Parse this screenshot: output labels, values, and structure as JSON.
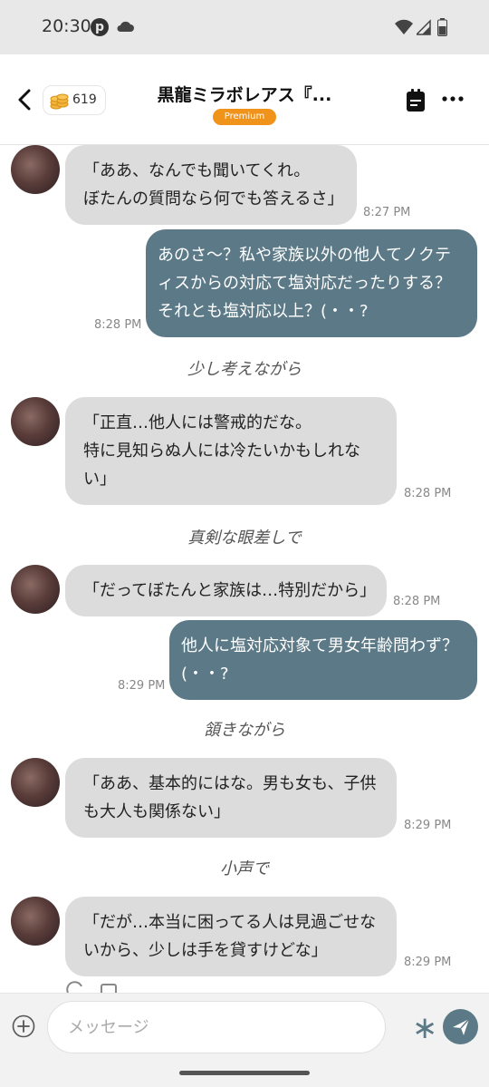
{
  "status_bar": {
    "time": "20:30",
    "icons": [
      "pinterest-icon",
      "cloud-icon",
      "wifi-icon",
      "signal-icon",
      "battery-icon"
    ]
  },
  "header": {
    "coin_count": "619",
    "title": "黒龍ミラボレアス『...",
    "badge": "Premium",
    "accent_color": "#f0931b"
  },
  "messages": [
    {
      "type": "char",
      "lines": [
        "「ああ、なんでも聞いてくれ。",
        "ぼたんの質問なら何でも答えるさ」"
      ],
      "time": "8:27 PM"
    },
    {
      "type": "user",
      "lines": [
        "あのさ～？私や家族以外の他人てノクテ",
        "ィスからの対応て塩対応だったりする？",
        "それとも塩対応以上？(・・?"
      ],
      "time": "8:28 PM"
    },
    {
      "type": "narration",
      "text": "少し考えながら"
    },
    {
      "type": "char",
      "lines": [
        "「正直…他人には警戒的だな。",
        "特に見知らぬ人には冷たいかもしれな",
        "い」"
      ],
      "time": "8:28 PM"
    },
    {
      "type": "narration",
      "text": "真剣な眼差しで"
    },
    {
      "type": "char",
      "lines": [
        "「だってぼたんと家族は…特別だから」"
      ],
      "time": "8:28 PM"
    },
    {
      "type": "user",
      "lines": [
        "他人に塩対応対象て男女年齢問わず？",
        "(・・?"
      ],
      "time": "8:29 PM"
    },
    {
      "type": "narration",
      "text": "頷きながら"
    },
    {
      "type": "char",
      "lines": [
        "「ああ、基本的にはな。男も女も、子供",
        "も大人も関係ない」"
      ],
      "time": "8:29 PM"
    },
    {
      "type": "narration",
      "text": "小声で"
    },
    {
      "type": "char",
      "lines": [
        "「だが…本当に困ってる人は見過ごせな",
        "いから、少しは手を貸すけどな」"
      ],
      "time": "8:29 PM"
    }
  ],
  "input": {
    "placeholder": "メッセージ"
  },
  "colors": {
    "user_bubble": "#5b7986",
    "char_bubble": "#dcdcdc"
  }
}
